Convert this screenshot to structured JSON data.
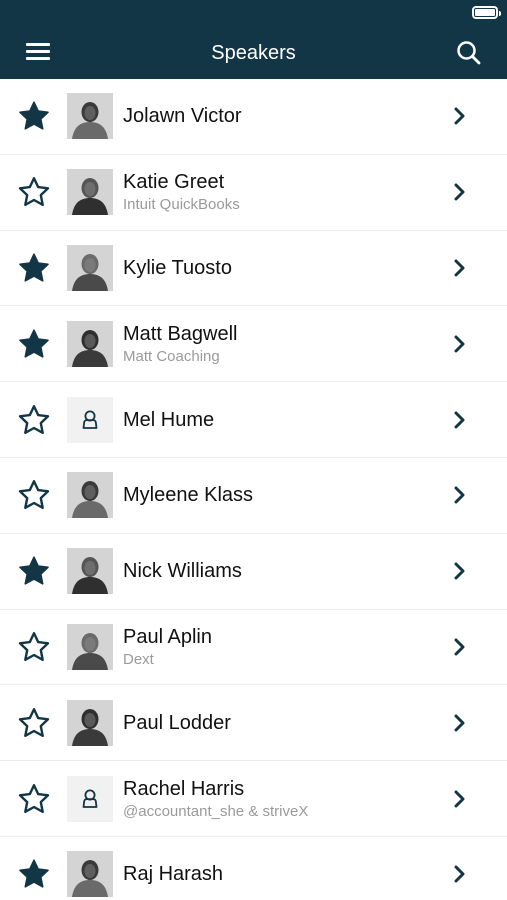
{
  "header": {
    "title": "Speakers",
    "background": "#123645",
    "battery_level": 1.0
  },
  "theme": {
    "accent": "#123645",
    "subtitle_color": "#9a9a9a"
  },
  "speakers": [
    {
      "name": "Jolawn Victor",
      "subtitle": "",
      "favorite": true,
      "avatar": "photo"
    },
    {
      "name": "Katie Greet",
      "subtitle": "Intuit QuickBooks",
      "favorite": false,
      "avatar": "photo"
    },
    {
      "name": "Kylie Tuosto",
      "subtitle": "",
      "favorite": true,
      "avatar": "photo"
    },
    {
      "name": "Matt Bagwell",
      "subtitle": "Matt Coaching",
      "favorite": true,
      "avatar": "photo"
    },
    {
      "name": "Mel Hume",
      "subtitle": "",
      "favorite": false,
      "avatar": "placeholder"
    },
    {
      "name": "Myleene Klass",
      "subtitle": "",
      "favorite": false,
      "avatar": "photo"
    },
    {
      "name": "Nick Williams",
      "subtitle": "",
      "favorite": true,
      "avatar": "photo"
    },
    {
      "name": "Paul Aplin",
      "subtitle": "Dext",
      "favorite": false,
      "avatar": "photo"
    },
    {
      "name": "Paul Lodder",
      "subtitle": "",
      "favorite": false,
      "avatar": "photo"
    },
    {
      "name": "Rachel Harris",
      "subtitle": "@accountant_she & striveX",
      "favorite": false,
      "avatar": "placeholder"
    },
    {
      "name": "Raj Harash",
      "subtitle": "",
      "favorite": true,
      "avatar": "photo"
    }
  ]
}
